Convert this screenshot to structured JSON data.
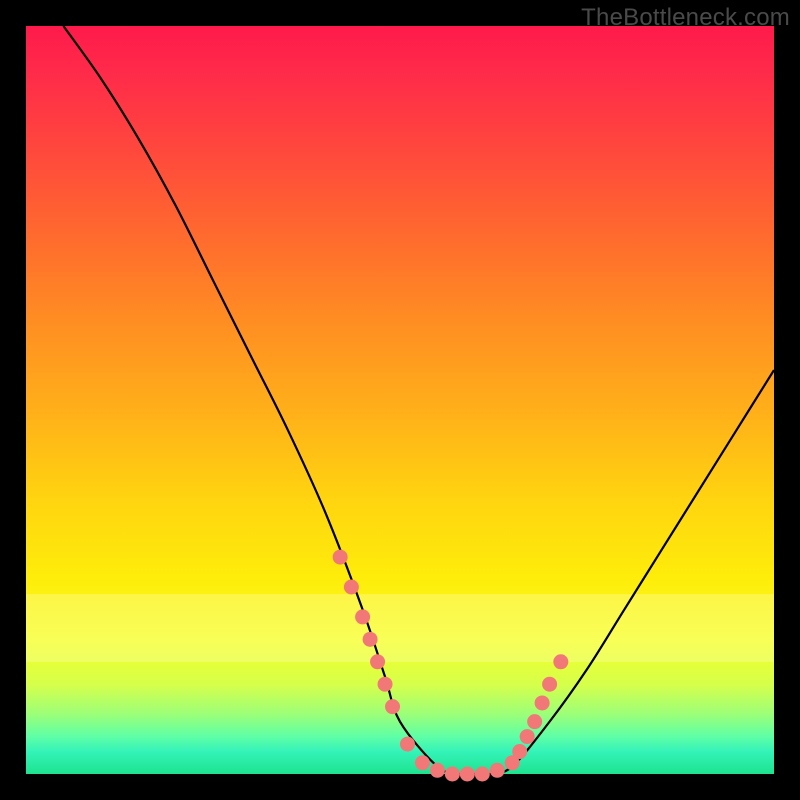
{
  "watermark": "TheBottleneck.com",
  "chart_data": {
    "type": "line",
    "title": "",
    "xlabel": "",
    "ylabel": "",
    "xlim": [
      0,
      100
    ],
    "ylim": [
      0,
      100
    ],
    "grid": false,
    "series": [
      {
        "name": "curve",
        "x": [
          5,
          10,
          15,
          20,
          25,
          30,
          35,
          40,
          45,
          48,
          50,
          55,
          58,
          60,
          62,
          65,
          70,
          75,
          80,
          85,
          90,
          95,
          100
        ],
        "y": [
          100,
          93,
          85,
          76,
          66,
          56,
          46,
          35,
          22,
          13,
          7,
          1,
          0,
          0,
          0,
          1,
          7,
          14,
          22,
          30,
          38,
          46,
          54
        ]
      }
    ],
    "markers": {
      "name": "highlight-dots",
      "x": [
        42,
        43.5,
        45,
        46,
        47,
        48,
        49,
        51,
        53,
        55,
        57,
        59,
        61,
        63,
        65,
        66,
        67,
        68,
        69,
        70,
        71.5
      ],
      "y": [
        29,
        25,
        21,
        18,
        15,
        12,
        9,
        4,
        1.5,
        0.5,
        0,
        0,
        0,
        0.5,
        1.5,
        3,
        5,
        7,
        9.5,
        12,
        15
      ]
    },
    "gradient_stops": [
      {
        "pct": 0,
        "color": "#ff1a4b"
      },
      {
        "pct": 14,
        "color": "#ff4040"
      },
      {
        "pct": 40,
        "color": "#ff8f22"
      },
      {
        "pct": 64,
        "color": "#ffd60f"
      },
      {
        "pct": 82,
        "color": "#f6ff27"
      },
      {
        "pct": 95,
        "color": "#5effa6"
      },
      {
        "pct": 100,
        "color": "#1de38f"
      }
    ]
  }
}
